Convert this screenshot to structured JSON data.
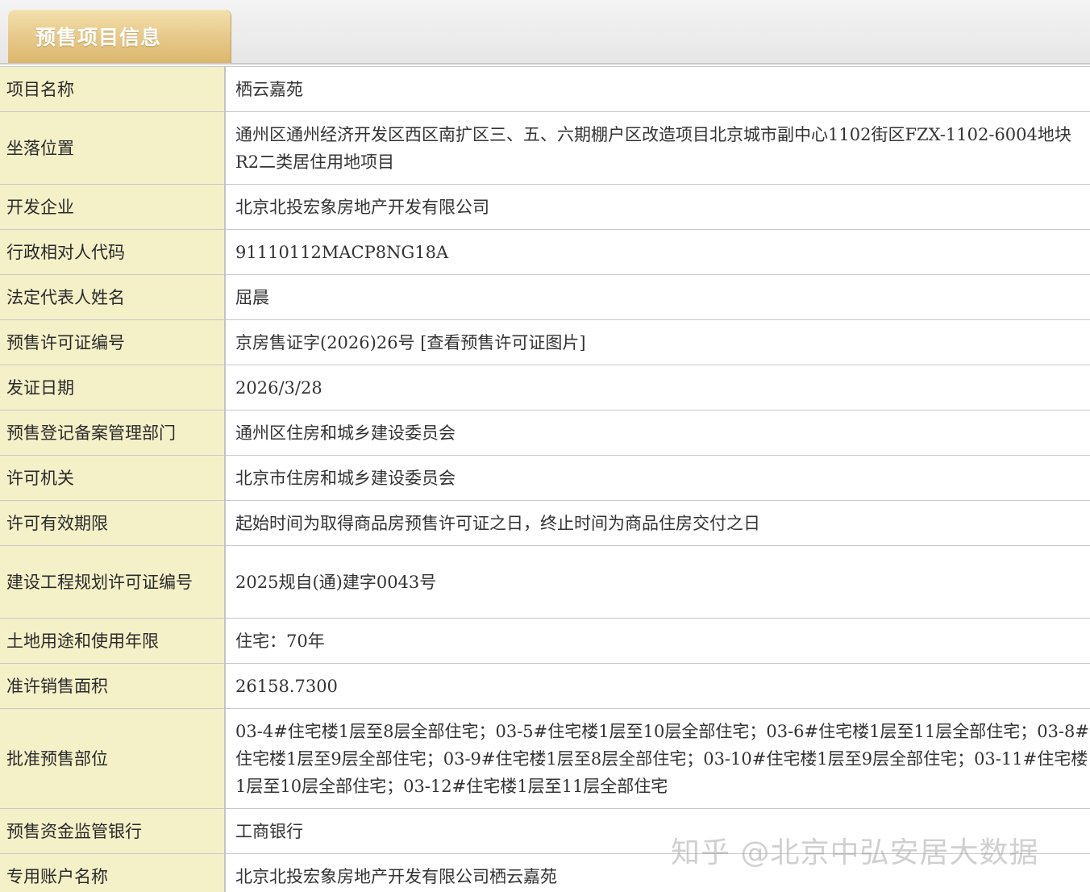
{
  "tab": {
    "label": "预售项目信息"
  },
  "rows": [
    {
      "label": "项目名称",
      "value": "栖云嘉苑"
    },
    {
      "label": "坐落位置",
      "value": "通州区通州经济开发区西区南扩区三、五、六期棚户区改造项目北京城市副中心1102街区FZX-1102-6004地块R2二类居住用地项目"
    },
    {
      "label": "开发企业",
      "value": "北京北投宏象房地产开发有限公司"
    },
    {
      "label": "行政相对人代码",
      "value": "91110112MACP8NG18A"
    },
    {
      "label": "法定代表人姓名",
      "value": "屈晨"
    },
    {
      "label": "预售许可证编号",
      "value": "京房售证字(2026)26号 [查看预售许可证图片]"
    },
    {
      "label": "发证日期",
      "value": "2026/3/28"
    },
    {
      "label": "预售登记备案管理部门",
      "value": "通州区住房和城乡建设委员会"
    },
    {
      "label": "许可机关",
      "value": "北京市住房和城乡建设委员会"
    },
    {
      "label": "许可有效期限",
      "value": "起始时间为取得商品房预售许可证之日，终止时间为商品住房交付之日"
    },
    {
      "label": "建设工程规划许可证编号",
      "value": "2025规自(通)建字0043号"
    },
    {
      "label": "土地用途和使用年限",
      "value": "住宅：70年"
    },
    {
      "label": "准许销售面积",
      "value": "26158.7300"
    },
    {
      "label": "批准预售部位",
      "value": "03-4#住宅楼1层至8层全部住宅；03-5#住宅楼1层至10层全部住宅；03-6#住宅楼1层至11层全部住宅；03-8#住宅楼1层至9层全部住宅；03-9#住宅楼1层至8层全部住宅；03-10#住宅楼1层至9层全部住宅；03-11#住宅楼1层至10层全部住宅；03-12#住宅楼1层至11层全部住宅"
    },
    {
      "label": "预售资金监管银行",
      "value": "工商银行"
    },
    {
      "label": "专用账户名称",
      "value": "北京北投宏象房地产开发有限公司栖云嘉苑"
    }
  ],
  "watermark": "知乎 @北京中弘安居大数据"
}
